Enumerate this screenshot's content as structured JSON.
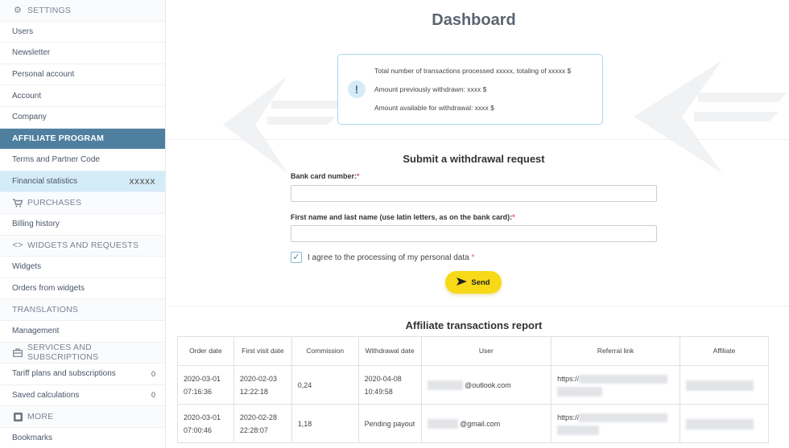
{
  "sidebar": {
    "settings_section": "SETTINGS",
    "settings_items": [
      "Users",
      "Newsletter",
      "Personal account",
      "Account",
      "Company"
    ],
    "affiliate_section": "AFFILIATE PROGRAM",
    "affiliate_items": [
      "Terms and Partner Code",
      "Financial statistics"
    ],
    "financial_count": "XXXXX",
    "purchases_section": "PURCHASES",
    "purchases_items": [
      "Billing history"
    ],
    "widgets_section": "WIDGETS AND REQUESTS",
    "widgets_items": [
      "Widgets",
      "Orders from widgets"
    ],
    "translations_section": "TRANSLATIONS",
    "translations_items": [
      "Management"
    ],
    "services_section": "SERVICES AND SUBSCRIPTIONS",
    "services_items": [
      {
        "label": "Tariff plans and subscriptions",
        "count": "0"
      },
      {
        "label": "Saved calculations",
        "count": "0"
      }
    ],
    "more_section": "MORE",
    "more_items": [
      "Bookmarks"
    ]
  },
  "dashboard": {
    "title": "Dashboard",
    "info_lines": [
      "Total number of transactions processed xxxxx, totaling of xxxxx $",
      "Amount previously withdrawn: xxxx $",
      "Amount available for withdrawal: xxxx $"
    ]
  },
  "withdrawal": {
    "title": "Submit a withdrawal request",
    "card_label": "Bank card number:",
    "name_label": "First name and last name (use latin letters, as on the bank card):",
    "required_mark": "*",
    "consent_label": "I agree to the processing of my personal data",
    "consent_checked": true,
    "send_label": "Send"
  },
  "report": {
    "title": "Affiliate transactions report",
    "columns": [
      "Order date",
      "First visit date",
      "Commission",
      "Withdrawal date",
      "User",
      "Referral link",
      "Affiliate"
    ],
    "rows": [
      {
        "order_date": "2020-03-01 07:16:36",
        "first_visit": "2020-02-03 12:22:18",
        "commission": "0,24",
        "withdrawal": "2020-04-08 10:49:58",
        "user_suffix": "@outlook.com",
        "referral_prefix": "https://"
      },
      {
        "order_date": "2020-03-01 07:00:46",
        "first_visit": "2020-02-28 22:28:07",
        "commission": "1,18",
        "withdrawal": "Pending payout",
        "user_suffix": "@gmail.com",
        "referral_prefix": "https://"
      }
    ]
  },
  "colors": {
    "accent_section": "#4f7f9f",
    "selected_item": "#d4ecf7",
    "send_button": "#f7d917",
    "info_border": "#a9d6ec"
  }
}
